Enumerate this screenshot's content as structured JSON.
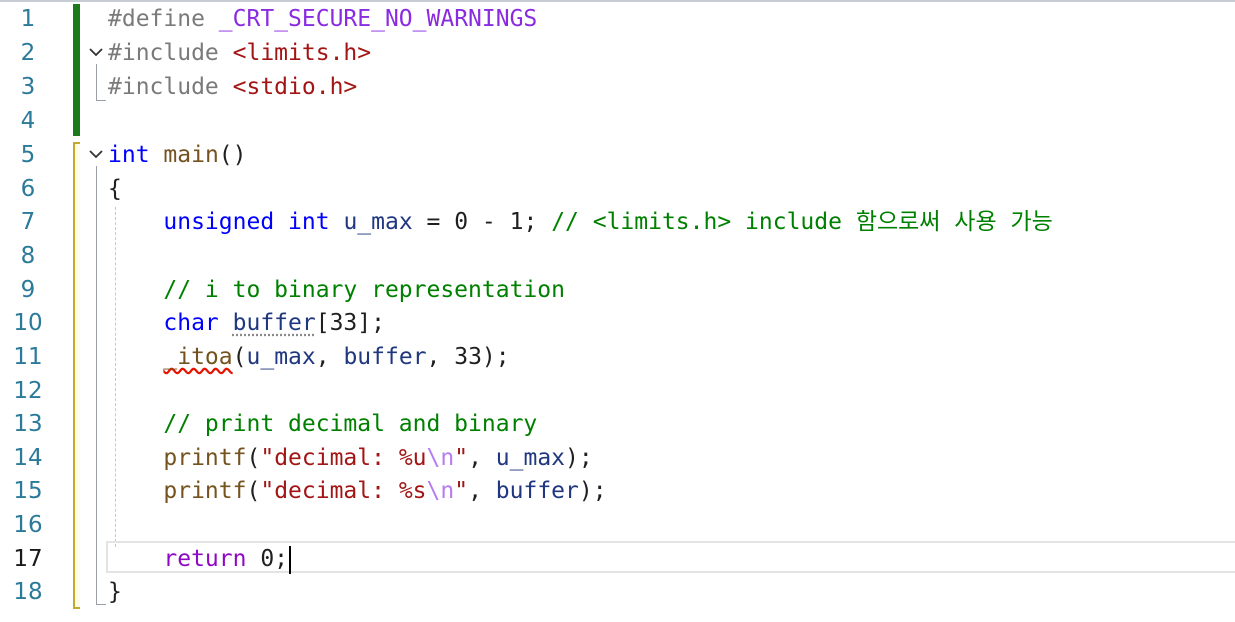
{
  "editor": {
    "line_numbers": [
      "1",
      "2",
      "3",
      "4",
      "5",
      "6",
      "7",
      "8",
      "9",
      "10",
      "11",
      "12",
      "13",
      "14",
      "15",
      "16",
      "17",
      "18"
    ],
    "current_line": "17",
    "code": {
      "l1_directive": "#define",
      "l1_macro": "_CRT_SECURE_NO_WARNINGS",
      "l2_directive": "#include",
      "l2_header": "<limits.h>",
      "l3_directive": "#include",
      "l3_header": "<stdio.h>",
      "l5_type": "int",
      "l5_func": "main",
      "l5_parens": "()",
      "l6_brace": "{",
      "l7_kw1": "unsigned",
      "l7_kw2": "int",
      "l7_var": "u_max",
      "l7_expr": "= 0 - 1;",
      "l7_comment": "// <limits.h> include 함으로써 사용 가능",
      "l9_comment": "// i to binary representation",
      "l10_kw": "char",
      "l10_var": "buffer",
      "l10_rest": "[33];",
      "l11_func": "_itoa",
      "l11_open": "(",
      "l11_arg1": "u_max",
      "l11_sep": ", ",
      "l11_arg2": "buffer",
      "l11_rest": ", 33);",
      "l13_comment": "// print decimal and binary",
      "l14_func": "printf",
      "l14_open": "(",
      "l14_str": "\"decimal: %u",
      "l14_esc": "\\n",
      "l14_strend": "\"",
      "l14_sep": ", ",
      "l14_var": "u_max",
      "l14_close": ");",
      "l15_func": "printf",
      "l15_open": "(",
      "l15_str": "\"decimal: %s",
      "l15_esc": "\\n",
      "l15_strend": "\"",
      "l15_sep": ", ",
      "l15_var": "buffer",
      "l15_close": ");",
      "l17_kw": "return",
      "l17_rest": " 0;",
      "l18_brace": "}"
    }
  }
}
